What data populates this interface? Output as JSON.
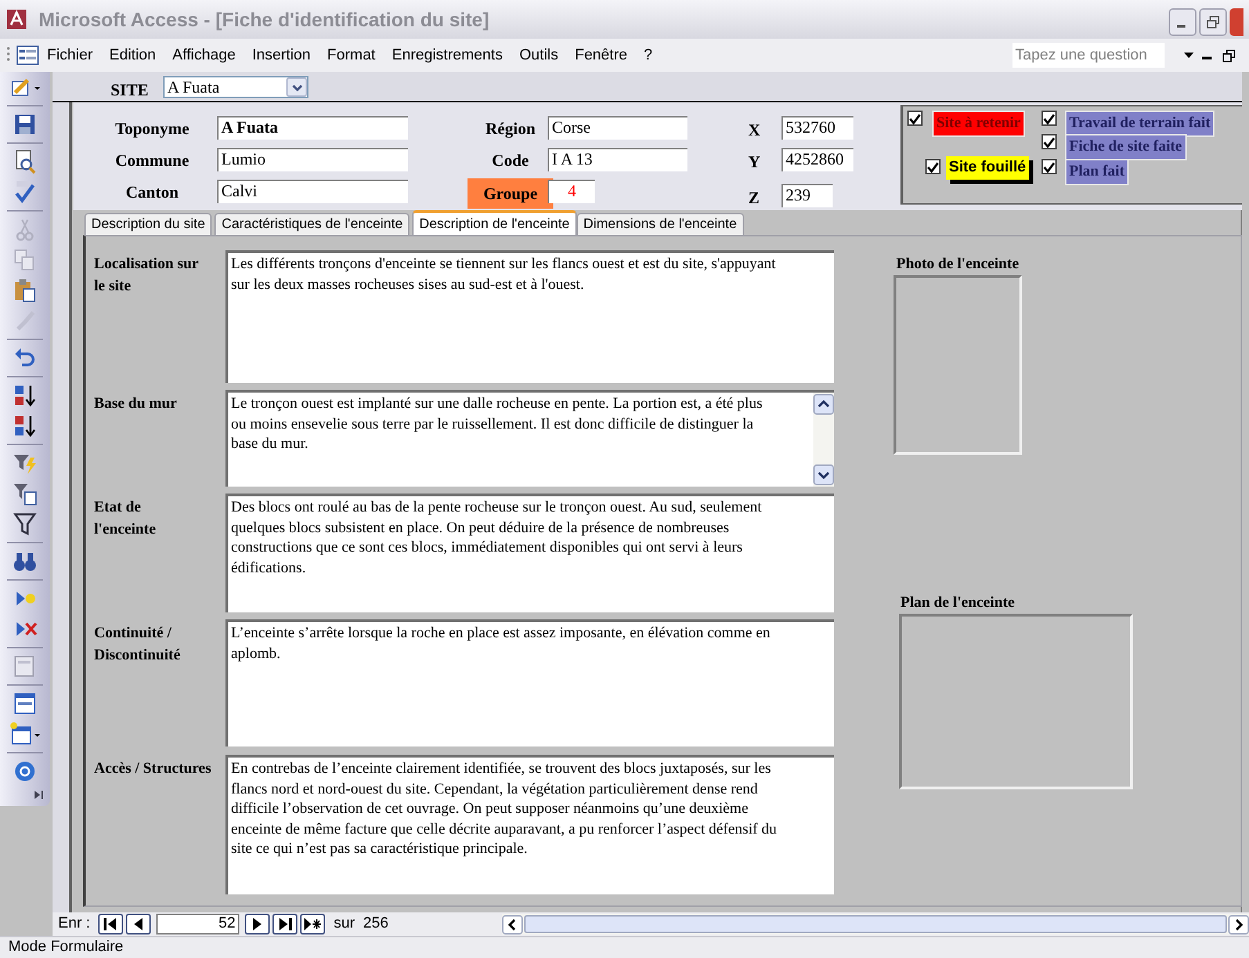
{
  "window": {
    "title": "Microsoft Access - [Fiche d'identification du site]"
  },
  "menu": {
    "items": [
      "Fichier",
      "Edition",
      "Affichage",
      "Insertion",
      "Format",
      "Enregistrements",
      "Outils",
      "Fenêtre",
      "?"
    ],
    "help_placeholder": "Tapez une question"
  },
  "header": {
    "site_label": "SITE",
    "site_value": "A Fuata"
  },
  "fields": [
    {
      "label": "Toponyme",
      "value": "A Fuata",
      "kind": "bold"
    },
    {
      "label": "Commune",
      "value": "Lumio",
      "kind": "plain"
    },
    {
      "label": "Canton",
      "value": "Calvi",
      "kind": "plain"
    },
    {
      "label": "Région",
      "value": "Corse",
      "kind": "plain"
    },
    {
      "label": "Code",
      "value": "I A 13",
      "kind": "plain"
    },
    {
      "label": "Groupe",
      "value": "4",
      "kind": "highlight"
    }
  ],
  "coordinates": [
    {
      "label": "X",
      "value": "532760"
    },
    {
      "label": "Y",
      "value": "4252860"
    },
    {
      "label": "Z",
      "value": "239"
    }
  ],
  "flags": [
    {
      "label": "Site à retenir",
      "checked": true,
      "color": "#ff0000"
    },
    {
      "label": "Travail de terrain fait",
      "checked": true,
      "color": "#8080c8"
    },
    {
      "label": "Fiche de site faite",
      "checked": true,
      "color": "#8080c8"
    },
    {
      "label": "Site fouillé",
      "checked": true,
      "color": "#ffff00"
    },
    {
      "label": "Plan fait",
      "checked": true,
      "color": "#8080c8"
    }
  ],
  "tabs": [
    {
      "label": "Description du site",
      "selected": false
    },
    {
      "label": "Caractéristiques de l'enceinte",
      "selected": false
    },
    {
      "label": "Description de l'enceinte",
      "selected": true
    },
    {
      "label": "Dimensions de l'enceinte",
      "selected": false
    }
  ],
  "memos": [
    {
      "label": "Localisation sur le site",
      "text": "Les différents tronçons d'enceinte se tiennent sur les flancs ouest et est du site, s'appuyant sur les deux masses rocheuses sises au sud-est et à l'ouest.",
      "kind": "plain"
    },
    {
      "label": "Base du mur",
      "text": "Le tronçon ouest est implanté sur une dalle rocheuse en pente. La portion est, a été plus ou moins ensevelie sous terre par le ruissellement. Il est donc difficile de distinguer la base du mur.",
      "kind": "scrolling"
    },
    {
      "label": "Etat de l'enceinte",
      "text": "Des blocs ont roulé au bas de la pente rocheuse sur le tronçon ouest. Au sud, seulement quelques blocs subsistent en place. On peut déduire de la présence de nombreuses constructions que ce sont ces blocs, immédiatement disponibles qui ont servi à leurs édifications.",
      "kind": "plain"
    },
    {
      "label": "Continuité / Discontinuité",
      "text": "L’enceinte s’arrête lorsque la roche en place est assez imposante, en élévation comme en aplomb.",
      "kind": "plain"
    },
    {
      "label": "Accès / Structures",
      "text": "En contrebas de l’enceinte clairement identifiée, se trouvent des blocs juxtaposés, sur les flancs nord et nord-ouest du site. Cependant, la végétation particulièrement dense rend difficile l’observation de cet ouvrage. On peut supposer néanmoins qu’une deuxième enceinte de même facture que celle décrite auparavant, a pu renforcer l’aspect défensif du site ce qui n’est pas sa caractéristique principale.",
      "kind": "plain"
    }
  ],
  "pictures": [
    {
      "label": "Photo de l'enceinte"
    },
    {
      "label": "Plan de l'enceinte"
    }
  ],
  "navigation": {
    "label": "Enr :",
    "current": "52",
    "of": "sur",
    "total": "256"
  },
  "status_bar": {
    "text": "Mode Formulaire"
  }
}
